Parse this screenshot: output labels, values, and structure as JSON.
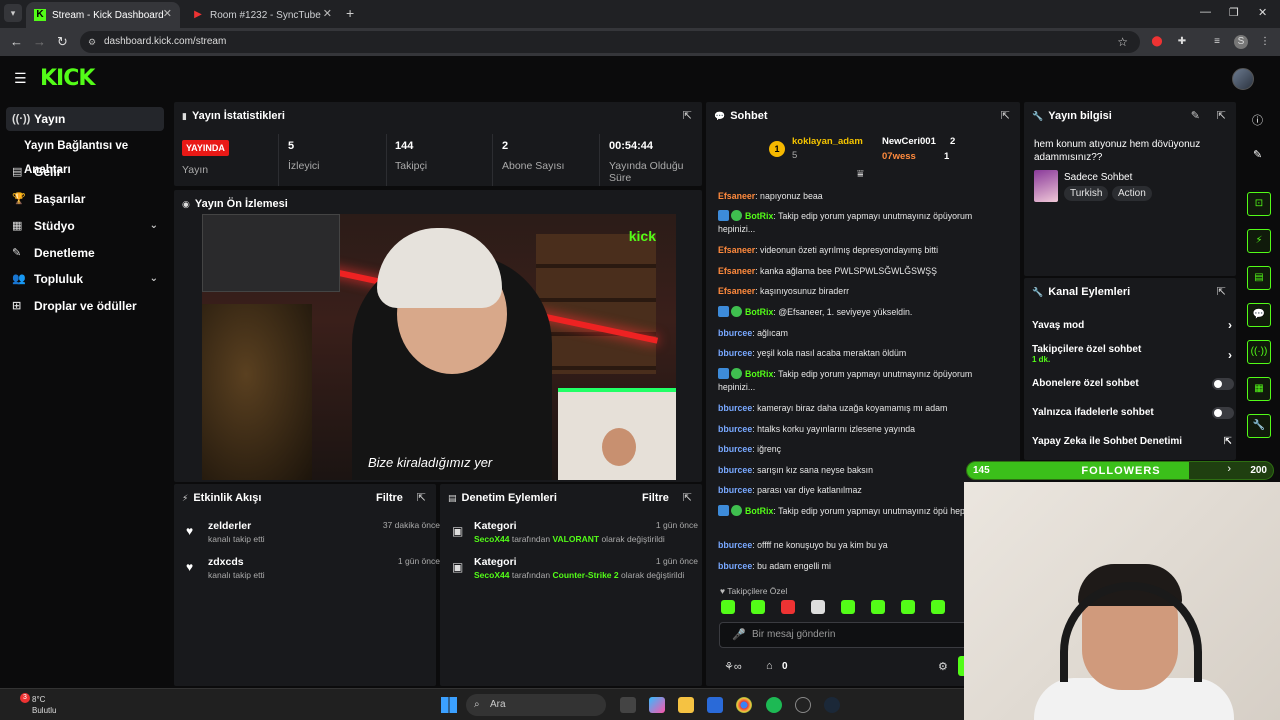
{
  "browser": {
    "tabs": [
      {
        "label": "Stream - Kick Dashboard",
        "active": true
      },
      {
        "label": "Room #1232 - SyncTube",
        "active": false
      }
    ],
    "url": "dashboard.kick.com/stream"
  },
  "header": {
    "logo": "KICK"
  },
  "sidebar": {
    "items": [
      {
        "label": "Yayın",
        "icon": "broadcast-icon"
      },
      {
        "label": "Yayın Bağlantısı ve Anahtarı",
        "icon": ""
      },
      {
        "label": "Gelir",
        "icon": "chart-icon"
      },
      {
        "label": "Başarılar",
        "icon": "trophy-icon"
      },
      {
        "label": "Stüdyo",
        "icon": "studio-icon"
      },
      {
        "label": "Denetleme",
        "icon": "wrench-icon"
      },
      {
        "label": "Topluluk",
        "icon": "community-icon"
      },
      {
        "label": "Droplar ve ödüller",
        "icon": "gift-icon"
      }
    ]
  },
  "stats": {
    "title": "Yayın İstatistikleri",
    "live_badge": "YAYINDA",
    "live_label": "Yayın",
    "viewers": "5",
    "viewers_label": "İzleyici",
    "followers": "144",
    "followers_label": "Takipçi",
    "subs": "2",
    "subs_label": "Abone Sayısı",
    "uptime": "00:54:44",
    "uptime_label": "Yayında Olduğu Süre"
  },
  "preview": {
    "title": "Yayın Ön İzlemesi",
    "caption": "Bize kiraladığımız yer"
  },
  "activity": {
    "title": "Etkinlik Akışı",
    "filter": "Filtre",
    "items": [
      {
        "name": "zelderler",
        "sub": "kanalı takip etti",
        "time": "37 dakika önce"
      },
      {
        "name": "zdxcds",
        "sub": "kanalı takip etti",
        "time": "1 gün önce"
      }
    ]
  },
  "moderation": {
    "title": "Denetim Eylemleri",
    "filter": "Filtre",
    "items": [
      {
        "name": "Kategori",
        "user": "SecoX44",
        "mid": "tarafından",
        "value": "VALORANT",
        "end": "olarak değiştirildi",
        "time": "1 gün önce"
      },
      {
        "name": "Kategori",
        "user": "SecoX44",
        "mid": "tarafından",
        "value": "Counter-Strike 2",
        "end": "olarak değiştirildi",
        "time": "1 gün önce"
      }
    ]
  },
  "chat": {
    "title": "Sohbet",
    "top": [
      {
        "rank": "1",
        "name": "koklayan_adam",
        "count": "5"
      },
      {
        "name": "NewCeri001",
        "count": "2"
      },
      {
        "name": "07wess",
        "count": "1"
      }
    ],
    "messages": [
      {
        "user": "Efsaneer",
        "text": ": napıyonuz beaa",
        "color": "orange",
        "bot": false
      },
      {
        "user": "BotRix",
        "text": ": Takip edip yorum yapmayı unutmayınız öpüyorum hepinizi...",
        "color": "green",
        "bot": true
      },
      {
        "user": "Efsaneer",
        "text": ": videonun özeti ayrılmış depresyondayımş bitti",
        "color": "orange",
        "bot": false
      },
      {
        "user": "Efsaneer",
        "text": ": kanka ağlama bee PWLSPWLSĞWLĞSWŞŞ",
        "color": "orange",
        "bot": false
      },
      {
        "user": "Efsaneer",
        "text": ": kaşınıyosunuz biraderr",
        "color": "orange",
        "bot": false
      },
      {
        "user": "BotRix",
        "text": ": @Efsaneer, 1. seviyeye yükseldin.",
        "color": "green",
        "bot": true
      },
      {
        "user": "bburcee",
        "text": ": ağlıcam",
        "color": "blue",
        "bot": false
      },
      {
        "user": "bburcee",
        "text": ": yeşil kola nasıl acaba meraktan öldüm",
        "color": "blue",
        "bot": false
      },
      {
        "user": "BotRix",
        "text": ": Takip edip yorum yapmayı unutmayınız öpüyorum hepinizi...",
        "color": "green",
        "bot": true
      },
      {
        "user": "bburcee",
        "text": ": kamerayı biraz daha uzağa koyamamış mı adam",
        "color": "blue",
        "bot": false
      },
      {
        "user": "bburcee",
        "text": ": htalks korku yayınlarını izlesene yayında",
        "color": "blue",
        "bot": false
      },
      {
        "user": "bburcee",
        "text": ": iğrenç",
        "color": "blue",
        "bot": false
      },
      {
        "user": "bburcee",
        "text": ": sarışın kız sana neyse baksın",
        "color": "blue",
        "bot": false
      },
      {
        "user": "bburcee",
        "text": ": parası var diye katlanılmaz",
        "color": "blue",
        "bot": false
      },
      {
        "user": "BotRix",
        "text": ": Takip edip yorum yapmayı unutmayınız öpü hepinizi...",
        "color": "green",
        "bot": true
      },
      {
        "user": "bburcee",
        "text": ": offff ne konuşuyo bu ya kim bu ya",
        "color": "blue",
        "bot": false
      },
      {
        "user": "bburcee",
        "text": ": bu adam engelli mi",
        "color": "blue",
        "bot": false
      }
    ],
    "followers_only": "Takipçilere Özel",
    "input_placeholder": "Bir mesaj gönderin",
    "points": "0"
  },
  "info": {
    "title": "Yayın bilgisi",
    "stream_title": "hem konum atıyonuz hem dövüyonuz adammısınız??",
    "category": "Sadece Sohbet",
    "tags": [
      "Turkish",
      "Action"
    ]
  },
  "channel_actions": {
    "title": "Kanal Eylemleri",
    "items": [
      {
        "label": "Yavaş mod",
        "kind": "arrow"
      },
      {
        "label": "Takipçilere özel sohbet",
        "kind": "arrow",
        "sub": "1 dk."
      },
      {
        "label": "Abonelere özel sohbet",
        "kind": "toggle"
      },
      {
        "label": "Yalnızca ifadelerle sohbet",
        "kind": "toggle"
      },
      {
        "label": "Yapay Zeka ile Sohbet Denetimi",
        "kind": "link"
      }
    ]
  },
  "followers_goal": {
    "current": "145",
    "label": "FOLLOWERS",
    "goal": "200",
    "progress": 0.725
  },
  "taskbar": {
    "weather_temp": "8°C",
    "weather_desc": "Bulutlu",
    "search": "Ara",
    "notification_count": "3"
  },
  "colors": {
    "accent": "#53fc18",
    "live": "#e91916",
    "panel": "#18191c"
  }
}
